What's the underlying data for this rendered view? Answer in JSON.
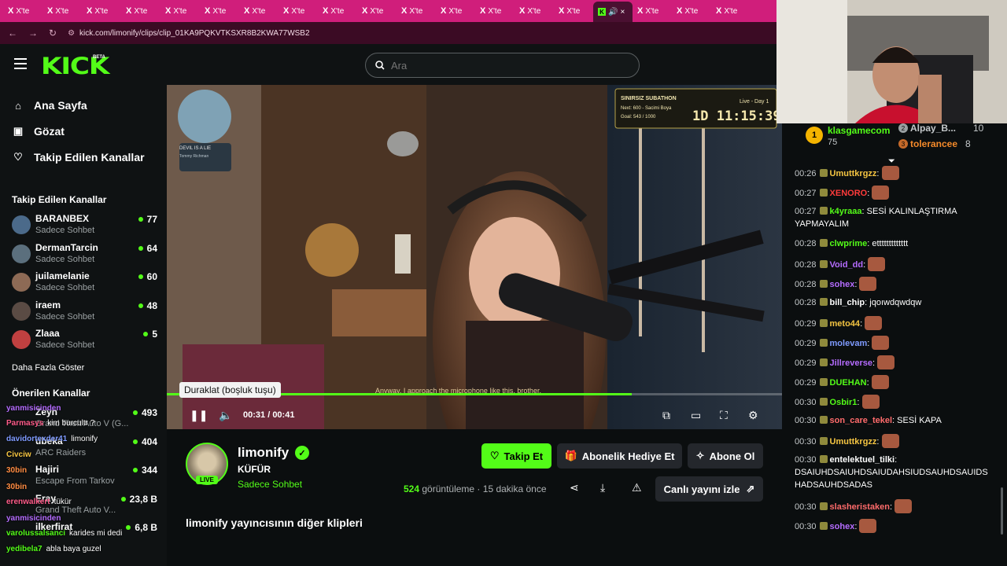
{
  "browser": {
    "tab_label": "X'te",
    "tab_count": 19,
    "url": "kick.com/limonify/clips/clip_01KA9PQKVTKSXR8B2KWA77WSB2"
  },
  "header": {
    "logo": "KICK",
    "logo_badge": "BETA",
    "search_placeholder": "Ara"
  },
  "sidebar": {
    "nav": [
      {
        "label": "Ana Sayfa",
        "icon": "home-icon"
      },
      {
        "label": "Gözat",
        "icon": "browse-icon"
      },
      {
        "label": "Takip Edilen Kanallar",
        "icon": "heart-icon"
      }
    ],
    "followed_title": "Takip Edilen Kanallar",
    "channels": [
      {
        "name": "BARANBEX",
        "sub": "Sadece Sohbet",
        "viewers": "77"
      },
      {
        "name": "DermanTarcin",
        "sub": "Sadece Sohbet",
        "viewers": "64"
      },
      {
        "name": "juilamelanie",
        "sub": "Sadece Sohbet",
        "viewers": "60"
      },
      {
        "name": "iraem",
        "sub": "Sadece Sohbet",
        "viewers": "48"
      },
      {
        "name": "Zlaaa",
        "sub": "Sadece Sohbet",
        "viewers": "5"
      }
    ],
    "show_more": "Daha Fazla Göster",
    "recommended_title": "Önerilen Kanallar",
    "recommended": [
      {
        "name": "Zeyn",
        "sub": "Grand Theft Auto V (G...",
        "viewers": "493"
      },
      {
        "name": "ubeka",
        "sub": "ARC Raiders",
        "viewers": "404"
      },
      {
        "name": "Hajiri",
        "sub": "Escape From Tarkov",
        "viewers": "344"
      },
      {
        "name": "Eray",
        "sub": "Grand Theft Auto V...",
        "viewers": "23,8 B"
      },
      {
        "name": "ilkerfirat",
        "sub": "",
        "viewers": "6,8 B"
      }
    ]
  },
  "overlay_chat": [
    {
      "user": "yanmisicinden",
      "text": ""
    },
    {
      "user": "Parmasys",
      "text": "kim burcultr ?"
    },
    {
      "user": "davidortexder41",
      "text": "limonify"
    },
    {
      "user": "Civciw",
      "text": ""
    },
    {
      "user": "30bin",
      "text": ""
    },
    {
      "user": "30bin",
      "text": ""
    },
    {
      "user": "erenwalkert",
      "text": "tükür"
    },
    {
      "user": "yanmisicinden",
      "text": ""
    },
    {
      "user": "varolussalsanci",
      "text": "karides mi dedi"
    },
    {
      "user": "yedibela7",
      "text": "abla baya guzel"
    }
  ],
  "player": {
    "tooltip": "Duraklat (boşluk tuşu)",
    "current": "00:31",
    "duration": "00:41",
    "progress": 0.756,
    "subtitle": "Anyway, I approach the microphone like this, brother.",
    "subathon": {
      "title": "SINIRSIZ SUBATHON",
      "next": "Next: 600 - Sacimi Boya",
      "goal": "Goal: 543 / 1000",
      "day": "Live - Day 1",
      "timer": "1D 11:15:39"
    },
    "overlay_card_title": "DEVIL IS A LIE",
    "overlay_card_sub": "Tommy Richman"
  },
  "clip": {
    "streamer": "limonify",
    "title": "KÜFÜR",
    "category": "Sadece Sohbet",
    "live": "LIVE",
    "follow": "Takip Et",
    "gift": "Abonelik Hediye Et",
    "subscribe": "Abone Ol",
    "views_count": "524",
    "views_label": "görüntüleme",
    "ago": "15 dakika önce",
    "watch_live": "Canlı yayını izle",
    "other_clips": "limonify yayıncısının diğer klipleri"
  },
  "leaderboard": [
    {
      "rank": "1",
      "name": "klasgamecom",
      "count": "75"
    },
    {
      "rank": "2",
      "name": "Alpay_B...",
      "count": "10"
    },
    {
      "rank": "3",
      "name": "tolerancee",
      "count": "8"
    }
  ],
  "chat": [
    {
      "t": "00:26",
      "user": "Umuttkrgzz",
      "color": "#f5c542",
      "msg": "",
      "emote": true
    },
    {
      "t": "00:27",
      "user": "XENORO",
      "color": "#ff3b3b",
      "msg": "",
      "emote": true
    },
    {
      "t": "00:27",
      "user": "k4yraaa",
      "color": "#53fc18",
      "msg": "SESİ KALINLAŞTIRMA YAPMAYALIM",
      "emote": false
    },
    {
      "t": "00:28",
      "user": "clwprime",
      "color": "#53fc18",
      "msg": "ettttttttttttt",
      "emote": false
    },
    {
      "t": "00:28",
      "user": "Void_dd",
      "color": "#b56cff",
      "msg": "",
      "emote": true
    },
    {
      "t": "00:28",
      "user": "sohex",
      "color": "#b56cff",
      "msg": "",
      "emote": true
    },
    {
      "t": "00:28",
      "user": "bill_chip",
      "color": "#ffffff",
      "msg": "jqoıwdqwdqw",
      "emote": false
    },
    {
      "t": "00:29",
      "user": "meto44",
      "color": "#f5c542",
      "msg": "",
      "emote": true
    },
    {
      "t": "00:29",
      "user": "molevam",
      "color": "#7f9bff",
      "msg": "",
      "emote": true
    },
    {
      "t": "00:29",
      "user": "Jillreverse",
      "color": "#b56cff",
      "msg": "",
      "emote": true
    },
    {
      "t": "00:29",
      "user": "DUEHAN",
      "color": "#53fc18",
      "msg": "",
      "emote": true
    },
    {
      "t": "00:30",
      "user": "Osbir1",
      "color": "#53fc18",
      "msg": "",
      "emote": true
    },
    {
      "t": "00:30",
      "user": "son_care_tekel",
      "color": "#ff6b6b",
      "msg": "SESİ KAPA",
      "emote": false
    },
    {
      "t": "00:30",
      "user": "Umuttkrgzz",
      "color": "#f5c542",
      "msg": "",
      "emote": true
    },
    {
      "t": "00:30",
      "user": "entelektuel_tilki",
      "color": "#ffffff",
      "msg": "DSAIUHDSAIUHDSAIUDAHSIUDSAUHDSAUIDS HADSAUHDSADAS",
      "emote": false
    },
    {
      "t": "00:30",
      "user": "slasheristaken",
      "color": "#ff6b6b",
      "msg": "",
      "emote": true
    },
    {
      "t": "00:30",
      "user": "sohex",
      "color": "#b56cff",
      "msg": "",
      "emote": true
    }
  ]
}
